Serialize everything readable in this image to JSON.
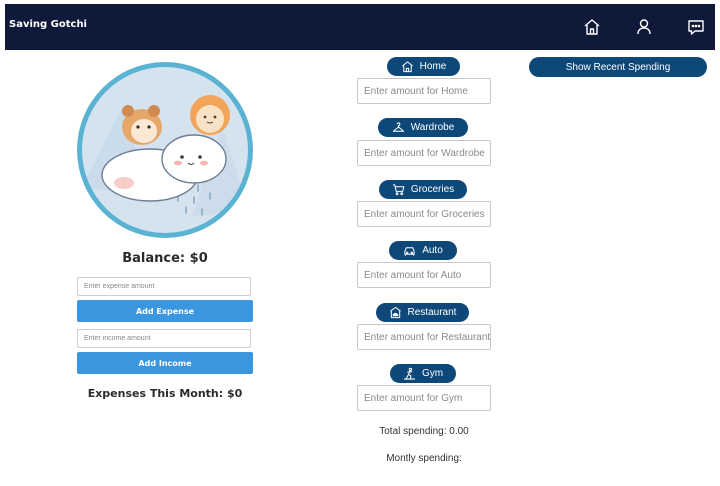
{
  "app": {
    "title": "Saving Gotchi"
  },
  "nav": {
    "items": [
      {
        "icon": "home-icon"
      },
      {
        "icon": "user-icon"
      },
      {
        "icon": "chat-icon"
      }
    ]
  },
  "left": {
    "balance": "Balance: $0",
    "expense_placeholder": "Enter expense amount",
    "add_expense_label": "Add Expense",
    "income_placeholder": "Enter income amount",
    "add_income_label": "Add Income",
    "expenses_month": "Expenses This Month: $0"
  },
  "categories": [
    {
      "label": "Home",
      "icon": "home-icon",
      "placeholder": "Enter amount for Home"
    },
    {
      "label": "Wardrobe",
      "icon": "hanger-icon",
      "placeholder": "Enter amount for Wardrobe"
    },
    {
      "label": "Groceries",
      "icon": "cart-icon",
      "placeholder": "Enter amount for Groceries"
    },
    {
      "label": "Auto",
      "icon": "car-icon",
      "placeholder": "Enter amount for Auto"
    },
    {
      "label": "Restaurant",
      "icon": "restaurant-icon",
      "placeholder": "Enter amount for Restaurant"
    },
    {
      "label": "Gym",
      "icon": "exercise-icon",
      "placeholder": "Enter amount for Gym"
    }
  ],
  "summary": {
    "total_spending": "Total spending: 0.00",
    "monthly_spending": "Montly spending:"
  },
  "right": {
    "recent_button": "Show Recent Spending"
  },
  "colors": {
    "navbar": "#0f1a3a",
    "accent_blue": "#3a96de",
    "pill_blue": "#0e4878",
    "avatar_ring": "#5bb3d3"
  }
}
